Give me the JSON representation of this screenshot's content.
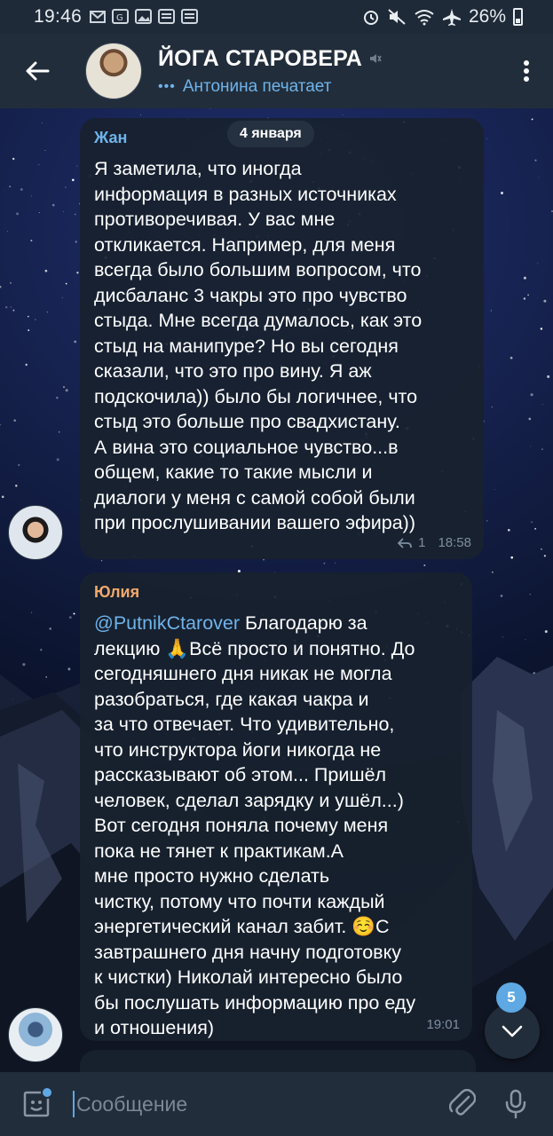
{
  "status_bar": {
    "time": "19:46",
    "battery": "26%"
  },
  "header": {
    "title": "ЙОГА СТАРОВЕРА",
    "status": "Антонина печатает",
    "typing_indicator": "•••"
  },
  "date_separator": "4 января",
  "messages": [
    {
      "sender": "Жан",
      "sender_color": "#6fb4ea",
      "text": "Я заметила, что иногда\nинформация в разных источниках\nпротиворечивая. У вас мне\nоткликается. Например, для меня\nвсегда было большим вопросом, что\nдисбаланс 3 чакры это про чувство\nстыда. Мне всегда думалось, как это\nстыд на манипуре? Но вы сегодня\nсказали, что это про вину. Я аж\nподскочила)) было бы логичнее, что\nстыд это больше про свадхистану.\nА вина это социальное чувство...в\nобщем, какие то такие мысли и\nдиалоги у меня с самой собой были\nпри прослушивании вашего эфира))",
      "replies": "1",
      "time": "18:58"
    },
    {
      "sender": "Юлия",
      "sender_color": "#f2a86b",
      "mention": "@PutnikCtarover",
      "text_after_mention": " Благодарю за\nлекцию 🙏Всё просто и понятно. До\nсегодняшнего дня  никак не могла\nразобраться, где какая чакра и\nза что отвечает. Что удивительно,\nчто инструктора йоги никогда не\nрассказывают об этом... Пришёл\nчеловек, сделал зарядку и  ушёл...)\nВот сегодня поняла почему меня\nпока не тянет к практикам.А\nмне просто нужно сделать\nчистку, потому что почти каждый\nэнергетический канал забит. ☺️С\nзавтрашнего дня начну подготовку\nк чистки)  Николай интересно было\nбы послушать информацию про еду\nи отношения)",
      "time": "19:01"
    }
  ],
  "unread_count": "5",
  "composer": {
    "placeholder": "Сообщение"
  },
  "colors": {
    "accent": "#5ea8e3",
    "header_bg": "#222d3b",
    "bubble_bg": "#18212e"
  }
}
